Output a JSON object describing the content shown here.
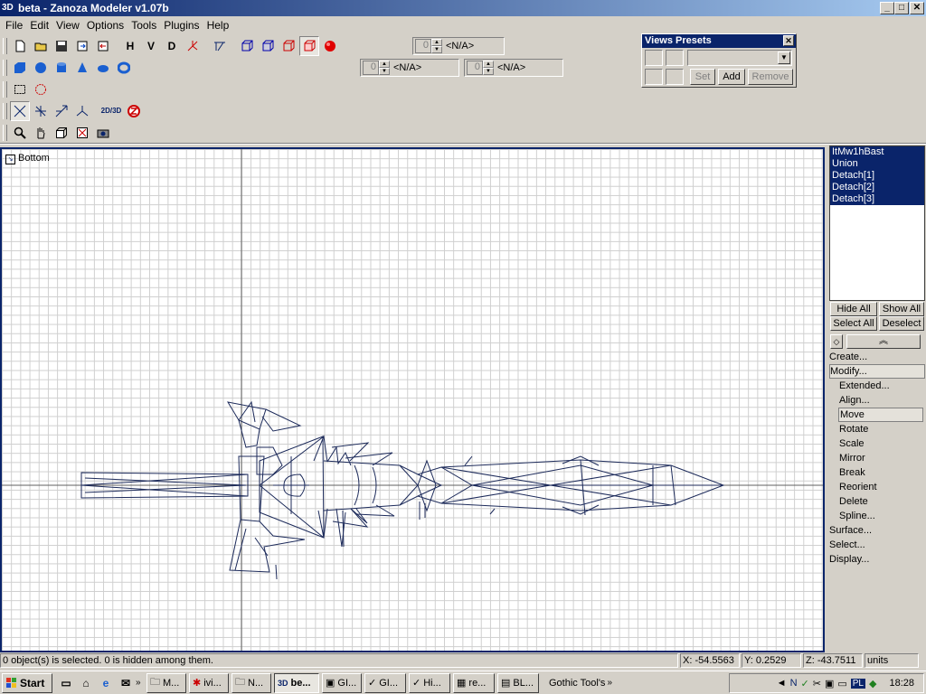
{
  "window": {
    "app_icon": "3D",
    "title": "beta - Zanoza Modeler v1.07b",
    "min": "_",
    "max": "□",
    "close": "✕"
  },
  "menu": [
    "File",
    "Edit",
    "View",
    "Options",
    "Tools",
    "Plugins",
    "Help"
  ],
  "toolbar": {
    "view_h": "H",
    "view_v": "V",
    "view_d": "D",
    "spinners": [
      {
        "value": "0",
        "label": "<N/A>"
      },
      {
        "value": "0",
        "label": "<N/A>"
      },
      {
        "value": "0",
        "label": "<N/A>"
      }
    ],
    "mode_2d3d": "2D/3D"
  },
  "views_presets": {
    "title": "Views Presets",
    "set": "Set",
    "add": "Add",
    "remove": "Remove"
  },
  "viewport": {
    "label": "Bottom"
  },
  "objects": [
    "ItMw1hBast",
    "Union",
    "Detach[1]",
    "Detach[2]",
    "Detach[3]"
  ],
  "side_buttons": {
    "hide_all": "Hide All",
    "show_all": "Show All",
    "select_all": "Select All",
    "deselect": "Deselect"
  },
  "commands": [
    {
      "label": "Create...",
      "sub": false,
      "highlight": false
    },
    {
      "label": "Modify...",
      "sub": false,
      "highlight": true
    },
    {
      "label": "Extended...",
      "sub": true,
      "highlight": false
    },
    {
      "label": "Align...",
      "sub": true,
      "highlight": false
    },
    {
      "label": "Move",
      "sub": true,
      "highlight": true
    },
    {
      "label": "Rotate",
      "sub": true,
      "highlight": false
    },
    {
      "label": "Scale",
      "sub": true,
      "highlight": false
    },
    {
      "label": "Mirror",
      "sub": true,
      "highlight": false
    },
    {
      "label": "Break",
      "sub": true,
      "highlight": false
    },
    {
      "label": "Reorient",
      "sub": true,
      "highlight": false
    },
    {
      "label": "Delete",
      "sub": true,
      "highlight": false
    },
    {
      "label": "Spline...",
      "sub": true,
      "highlight": false
    },
    {
      "label": "Surface...",
      "sub": false,
      "highlight": false
    },
    {
      "label": "Select...",
      "sub": false,
      "highlight": false
    },
    {
      "label": "Display...",
      "sub": false,
      "highlight": false
    }
  ],
  "status": {
    "message": "0 object(s) is selected. 0 is hidden among them.",
    "x": "X: -54.5563",
    "y": "Y: 0.2529",
    "z": "Z: -43.7511",
    "units": "units"
  },
  "taskbar": {
    "start": "Start",
    "tasks": [
      "M...",
      "ivi...",
      "N...",
      "be...",
      "GI...",
      "GI...",
      "Hi...",
      "re...",
      "BL..."
    ],
    "toolbar_label": "Gothic Tool's",
    "clock": "18:28",
    "lang": "PL"
  },
  "colors": {
    "title_blue": "#0a246a",
    "face": "#d4d0c8",
    "wire": "#1c2a5a"
  }
}
